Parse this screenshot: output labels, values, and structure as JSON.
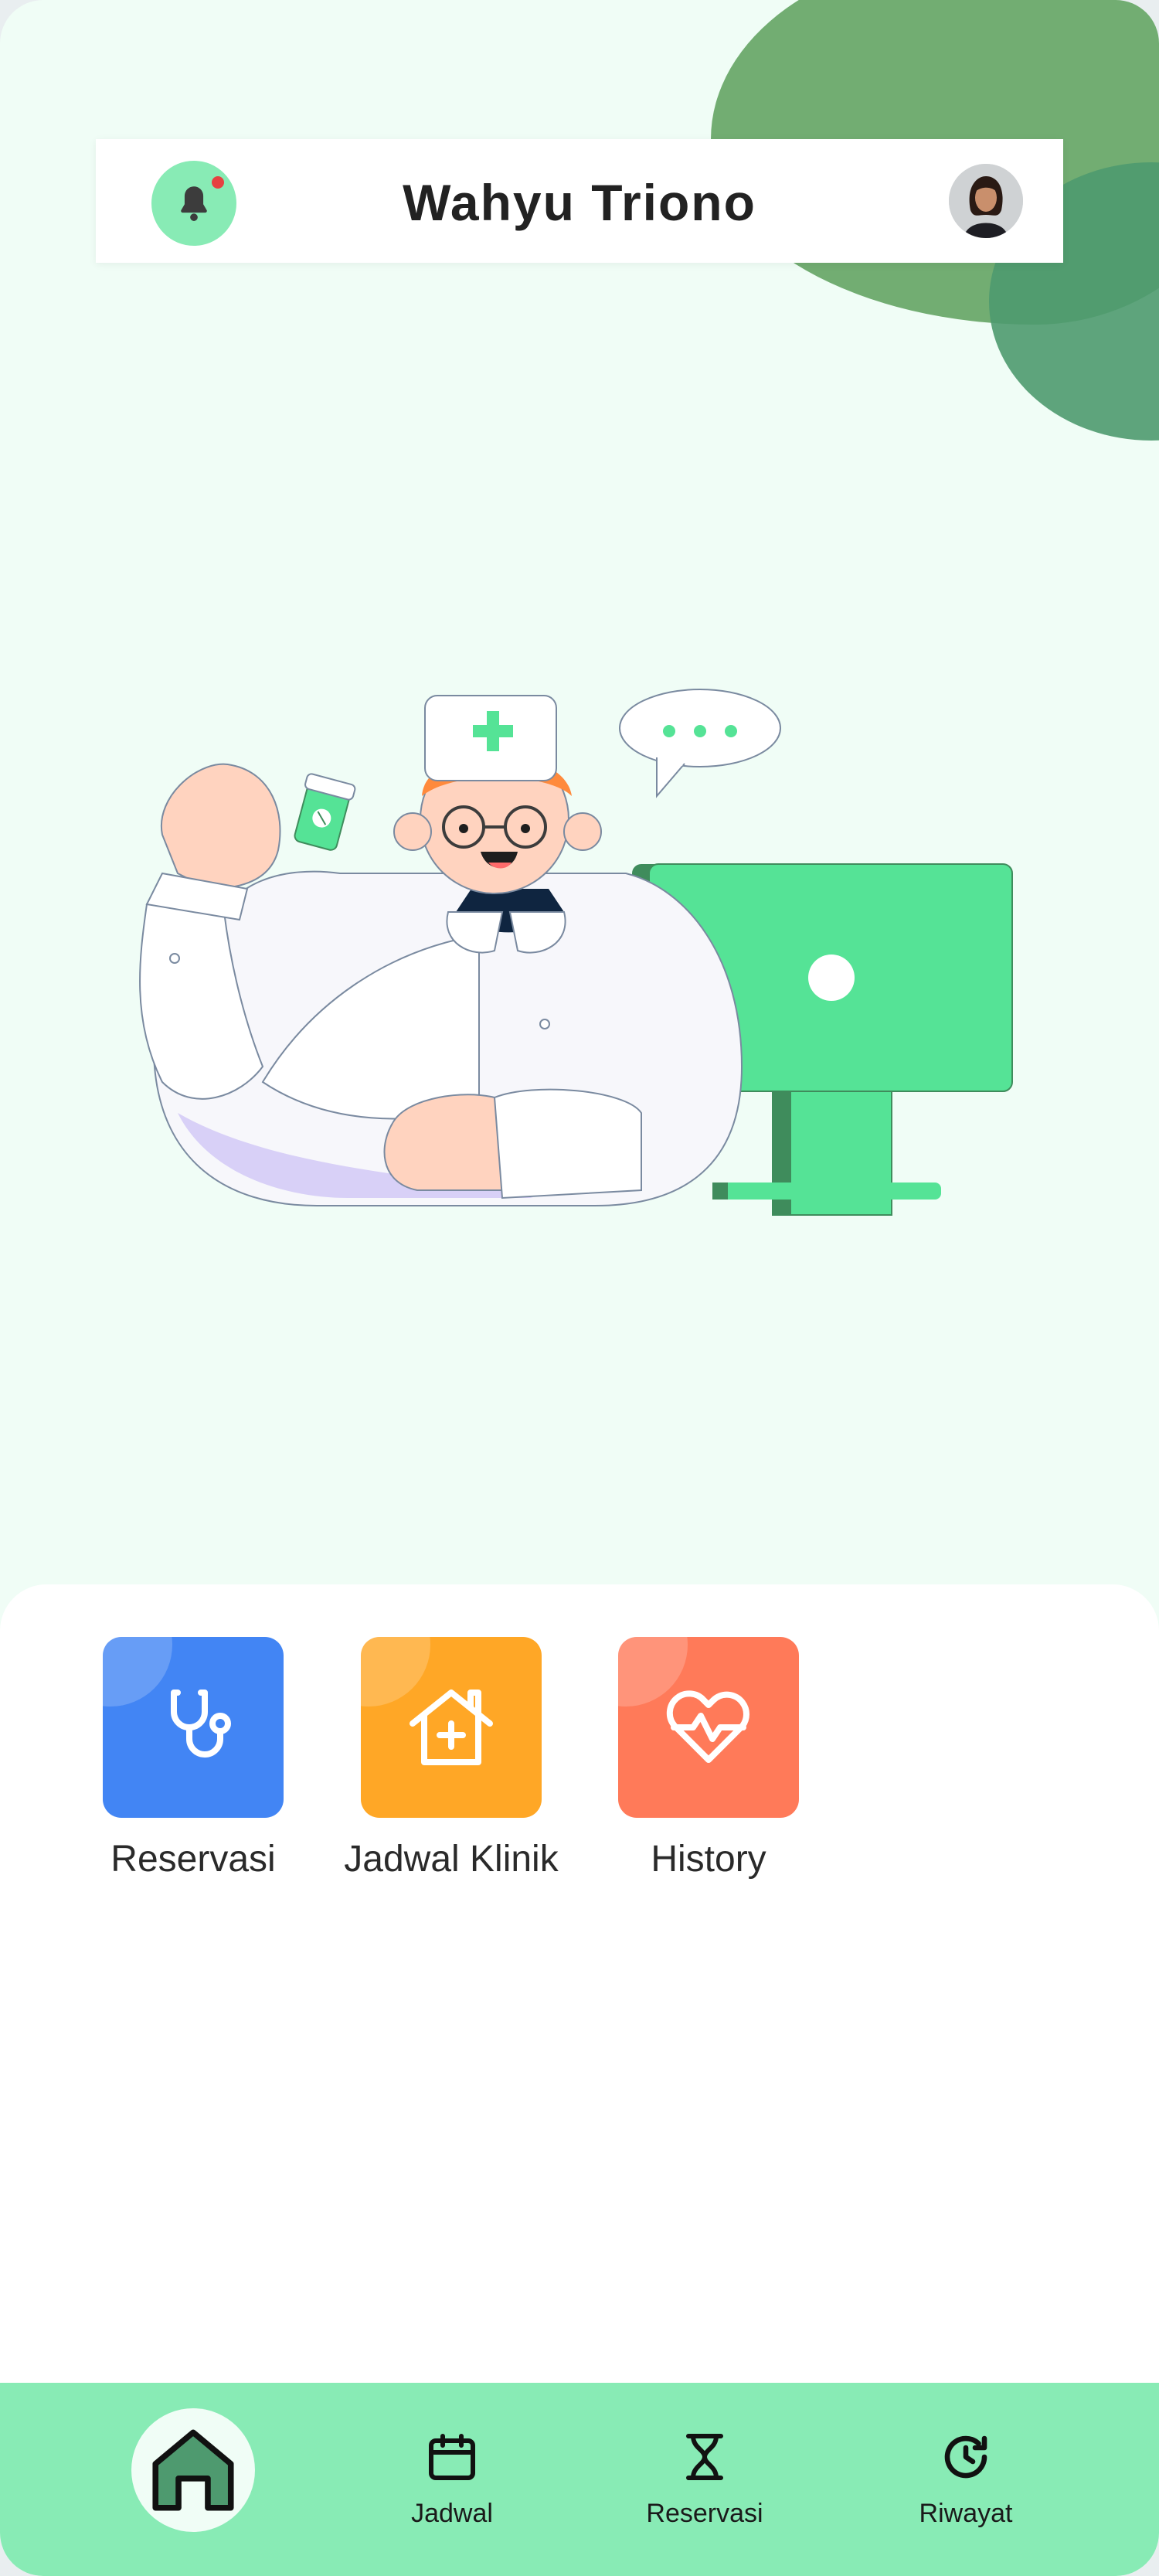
{
  "header": {
    "username": "Wahyu Triono",
    "notification_icon": "bell-icon",
    "has_unread_notification": true,
    "avatar_icon": "user-avatar"
  },
  "menu": {
    "tiles": [
      {
        "label": "Reservasi",
        "icon": "stethoscope-icon",
        "color": "#4285f4"
      },
      {
        "label": "Jadwal Klinik",
        "icon": "clinic-house-icon",
        "color": "#ffa726"
      },
      {
        "label": "History",
        "icon": "heart-pulse-icon",
        "color": "#ff7a59"
      }
    ]
  },
  "navbar": {
    "active": "home",
    "items": [
      {
        "label": "",
        "icon": "home-icon"
      },
      {
        "label": "Jadwal",
        "icon": "calendar-icon"
      },
      {
        "label": "Reservasi",
        "icon": "hourglass-icon"
      },
      {
        "label": "Riwayat",
        "icon": "history-icon"
      }
    ]
  },
  "colors": {
    "background": "#f0fdf6",
    "accent_green": "#55e396",
    "nav_green": "#88ebb5",
    "blob_green": "#72ad72",
    "dark_green": "#4e9a6f"
  }
}
